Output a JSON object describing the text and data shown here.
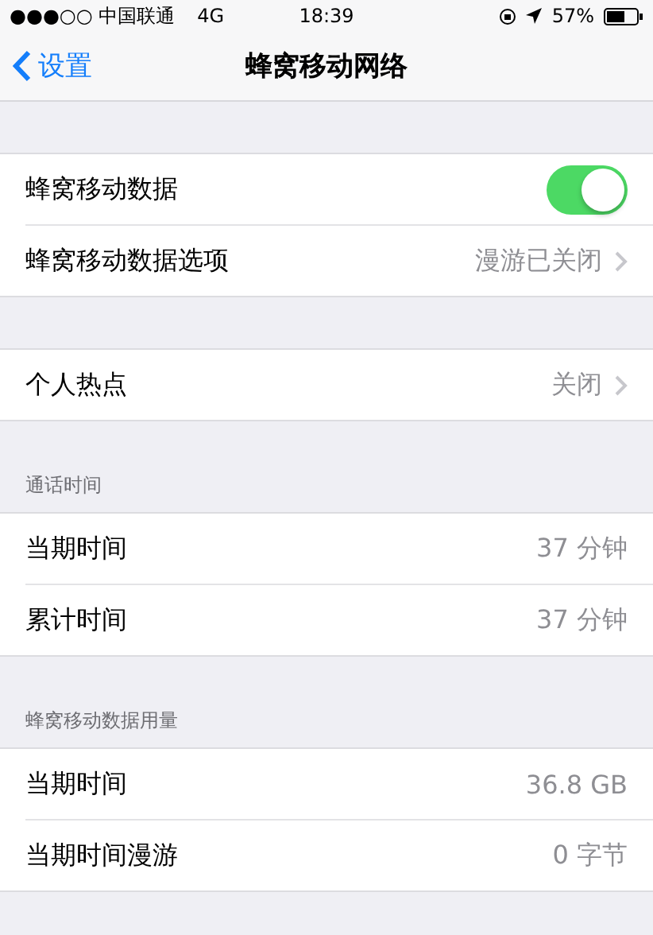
{
  "status_bar": {
    "carrier": "●●●○○ 中国联通",
    "network": "4G",
    "time": "18:39",
    "battery": "57%"
  },
  "nav": {
    "back": "设置",
    "title": "蜂窝移动网络"
  },
  "sections": [
    {
      "rows": [
        {
          "kind": "toggle",
          "label": "蜂窝移动数据",
          "on": true
        },
        {
          "kind": "disclosure",
          "label": "蜂窝移动数据选项",
          "value": "漫游已关闭"
        }
      ]
    },
    {
      "rows": [
        {
          "kind": "disclosure",
          "label": "个人热点",
          "value": "关闭"
        }
      ]
    },
    {
      "header": "通话时间",
      "rows": [
        {
          "kind": "value",
          "label": "当期时间",
          "value": "37 分钟"
        },
        {
          "kind": "value",
          "label": "累计时间",
          "value": "37 分钟"
        }
      ]
    },
    {
      "header": "蜂窝移动数据用量",
      "rows": [
        {
          "kind": "value",
          "label": "当期时间",
          "value": "36.8 GB"
        },
        {
          "kind": "value",
          "label": "当期时间漫游",
          "value": "0 字节"
        }
      ]
    }
  ]
}
